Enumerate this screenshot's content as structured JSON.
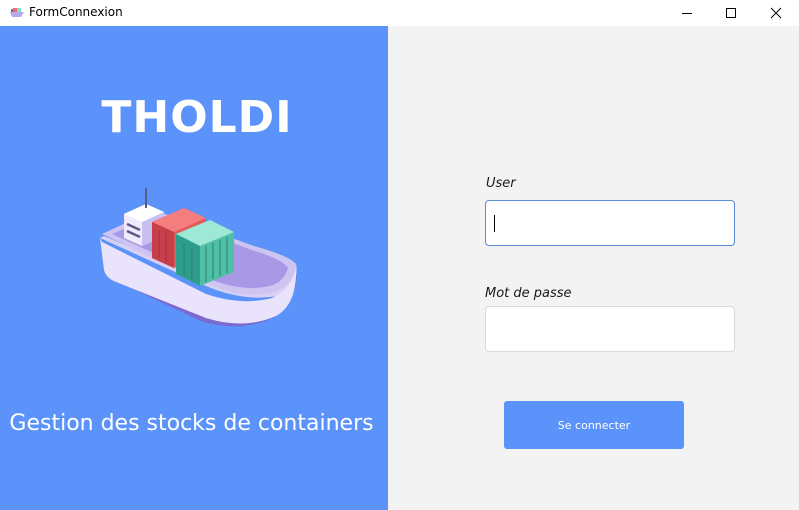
{
  "window": {
    "title": "FormConnexion",
    "icon": "ship-app-icon",
    "controls": [
      "minimize-icon",
      "maximize-icon",
      "close-icon"
    ]
  },
  "branding": {
    "title": "THOLDI",
    "subtitle": "Gestion des stocks de containers",
    "illustration": "cargo-ship-icon"
  },
  "form": {
    "user_label": "User",
    "user_value": "",
    "password_label": "Mot de passe",
    "password_value": "",
    "submit_label": "Se connecter"
  },
  "colors": {
    "accent": "#5b93fb",
    "background": "#f3f3f3",
    "focus_border": "#5b8ad6"
  }
}
